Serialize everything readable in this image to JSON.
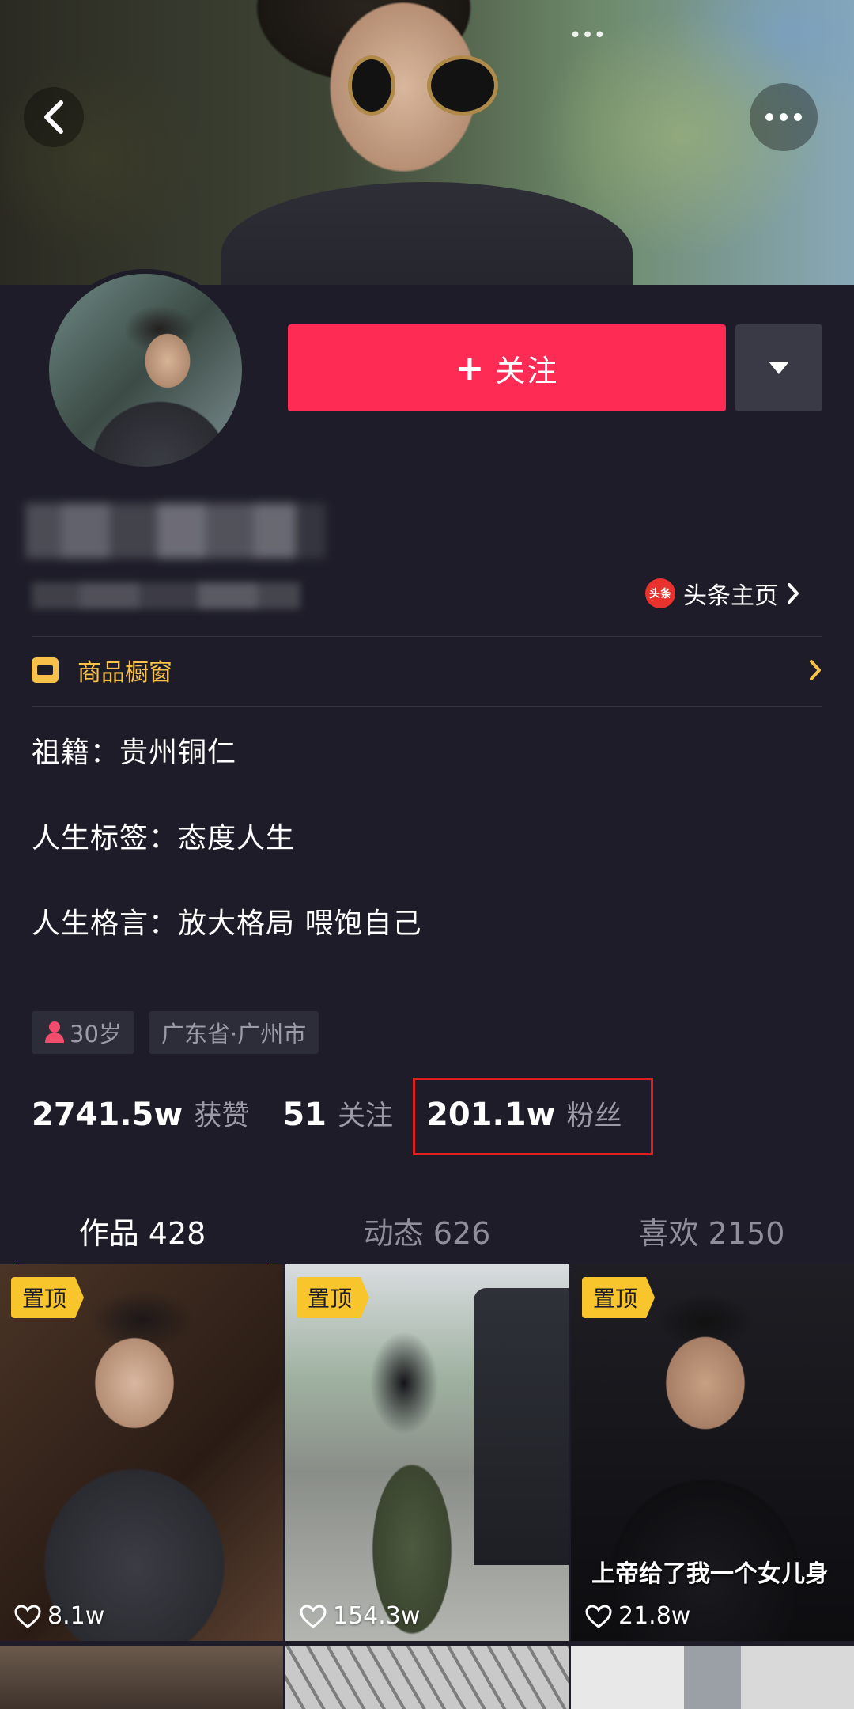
{
  "header": {
    "status_dots": "••• ",
    "follow_label": "关注",
    "follow_plus": "+"
  },
  "profile": {
    "toutiao_logo_text": "头条",
    "toutiao_link": "头条主页",
    "shop_label": "商品橱窗",
    "bio": {
      "hometown": "祖籍：贵州铜仁",
      "tags": "人生标签：态度人生",
      "motto": "人生格言：放大格局  喂饱自己"
    },
    "age_tag": "30岁",
    "location_tag": "广东省·广州市"
  },
  "stats": {
    "likes_num": "2741.5w",
    "likes_label": "获赞",
    "following_num": "51",
    "following_label": "关注",
    "fans_num": "201.1w",
    "fans_label": "粉丝"
  },
  "tabs": [
    {
      "label": "作品 428",
      "active": true
    },
    {
      "label": "动态 626",
      "active": false
    },
    {
      "label": "喜欢 2150",
      "active": false
    }
  ],
  "videos": [
    {
      "pin": "置顶",
      "likes": "8.1w",
      "caption": ""
    },
    {
      "pin": "置顶",
      "likes": "154.3w",
      "caption": ""
    },
    {
      "pin": "置顶",
      "likes": "21.8w",
      "caption": "上帝给了我一个女儿身"
    }
  ],
  "colors": {
    "background": "#1d1c28",
    "follow_button": "#fe2c55",
    "accent_yellow": "#f8c24a",
    "highlight_box": "#e02020",
    "muted_text": "#9b9aa6"
  }
}
